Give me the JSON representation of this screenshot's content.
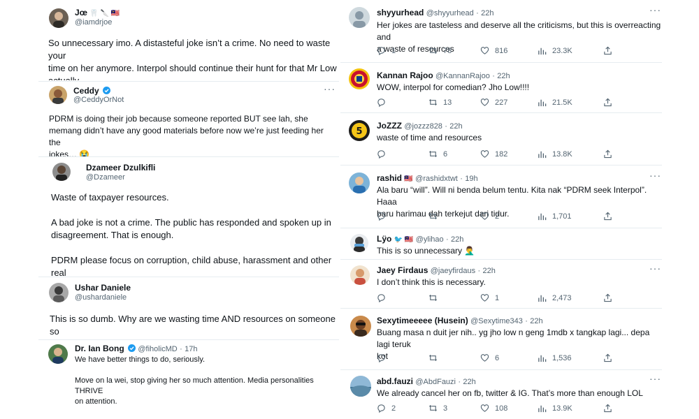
{
  "left": {
    "joe": {
      "name": "Jœ",
      "name_emoji": "🦷 🔪 🇲🇾",
      "handle": "@iamdrjoe",
      "text": "So unnecessary imo. A distasteful joke isn’t a crime. No need to waste your\ntime on her anymore. Interpol should continue their hunt for that Mr Low\nactually."
    },
    "ceddy": {
      "name": "Ceddy",
      "handle": "@CeddyOrNot",
      "text": "PDRM is doing their job because someone reported BUT see lah, she\nmemang didn’t have any good materials before now we’re just feeding her the\njokes… 😭"
    },
    "dzameer": {
      "name": "Dzameer Dzulkifli",
      "handle": "@Dzameer",
      "text": "Waste of taxpayer resources.\n\nA bad joke is not a crime. The public has responded and spoken up in\ndisagreement. That is enough.\n\nPDRM please focus on corruption, child abuse, harassment and other real\ncrimes."
    },
    "ushar": {
      "name": "Ushar Daniele",
      "handle": "@ushardaniele",
      "text": "This is so dumb. Why are we wasting time AND resources on someone so\ninsignificant?"
    },
    "ianbong": {
      "name": "Dr. Ian Bong",
      "handle": "@fiholicMD",
      "time": "17h",
      "text": "We have better things to do, seriously.\n\nMove on la wei, stop giving her so much attention. Media personalities THRIVE\non attention.\n\nShe’s a nobody until everyone became agitated."
    }
  },
  "right": {
    "shyyurhead": {
      "name": "shyyurhead",
      "handle": "@shyyurhead",
      "time": "22h",
      "text": "Her jokes are tasteless and deserve all the criticisms, but this is overreacting and\na waste of resources",
      "replies": "1",
      "retweets": "78",
      "likes": "816",
      "views": "23.3K"
    },
    "kannan": {
      "name": "Kannan Rajoo",
      "handle": "@KannanRajoo",
      "time": "22h",
      "text": "WOW, interpol for comedian? Jho Low!!!!",
      "replies": "",
      "retweets": "13",
      "likes": "227",
      "views": "21.5K"
    },
    "jozzz": {
      "name": "JoZZZ",
      "handle": "@jozzz828",
      "time": "22h",
      "text": "waste of time and resources",
      "replies": "",
      "retweets": "6",
      "likes": "182",
      "views": "13.8K"
    },
    "rashid": {
      "name": "rashid",
      "name_emoji": "🇲🇾",
      "handle": "@rashidxtwt",
      "time": "19h",
      "text": "Ala baru “will”. Will ni benda belum tentu. Kita nak “PDRM seek Interpol”. Haaa\nbaru harimau dah terkejut dari tidur.",
      "replies": "",
      "retweets": "",
      "likes": "2",
      "views": "1,701"
    },
    "lyo": {
      "name": "Lÿo",
      "name_emoji": "🐦 🇲🇾",
      "handle": "@ylihao",
      "time": "22h",
      "text": "This is so unnecessary 🤦‍♂️"
    },
    "jaey": {
      "name": "Jaey Firdaus",
      "handle": "@jaeyfirdaus",
      "time": "22h",
      "text": "I don’t think this is necessary.",
      "replies": "",
      "retweets": "",
      "likes": "1",
      "views": "2,473"
    },
    "sexytime": {
      "name": "Sexytimeeeee (Husein)",
      "handle": "@Sexytime343",
      "time": "22h",
      "text": "Buang masa n duit jer nih.. yg jho low n geng 1mdb x tangkap lagi... depa lagi teruk\nkot",
      "replies": "",
      "retweets": "",
      "likes": "6",
      "views": "1,536"
    },
    "abdfauzi": {
      "name": "abd.fauzi",
      "handle": "@AbdFauzi",
      "time": "22h",
      "text": "We already cancel her on fb, twitter & IG. That’s more than enough LOL",
      "replies": "2",
      "retweets": "3",
      "likes": "108",
      "views": "13.9K"
    }
  },
  "colors": {
    "verified": "#1d9bf0",
    "muted": "#536471",
    "text": "#0f1419",
    "border": "#e6ecf0"
  }
}
